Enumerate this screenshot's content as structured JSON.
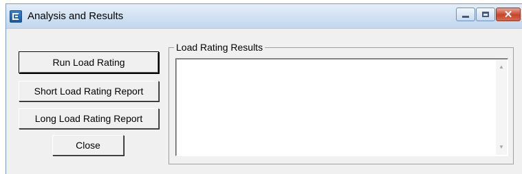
{
  "window": {
    "title": "Analysis and Results",
    "icon": "app-icon",
    "controls": {
      "minimize": "minimize-icon",
      "maximize": "maximize-icon",
      "close": "close-icon"
    },
    "close_glyph": "✕"
  },
  "buttons": {
    "run": "Run Load Rating",
    "short_report": "Short Load Rating Report",
    "long_report": "Long Load Rating Report",
    "close": "Close"
  },
  "results": {
    "group_label": "Load Rating Results",
    "text": "",
    "scroll_up": "▲",
    "scroll_down": "▼"
  },
  "colors": {
    "titlebar": "#c5d9ee",
    "close_button": "#c7432a",
    "face": "#f0f0f0"
  }
}
